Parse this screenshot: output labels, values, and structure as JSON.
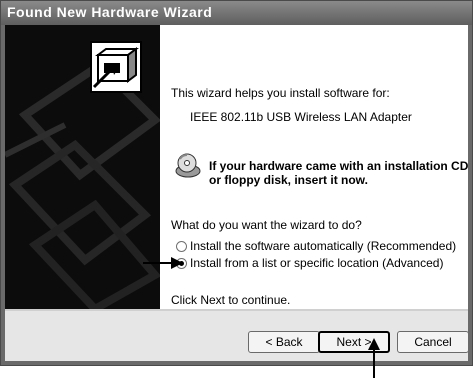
{
  "window": {
    "title": "Found New Hardware Wizard"
  },
  "content": {
    "intro": "This wizard helps you install software for:",
    "device": "IEEE 802.11b USB Wireless LAN Adapter",
    "cd_line1": "If your hardware came with an installation CD",
    "cd_line2": "or floppy disk, insert it now.",
    "question": "What do you want the wizard to do?",
    "option_auto": "Install the software automatically (Recommended)",
    "option_list": "Install from a list or specific location (Advanced)",
    "continue": "Click Next to continue."
  },
  "buttons": {
    "back": "< Back",
    "next": "Next >",
    "cancel": "Cancel"
  },
  "icons": {
    "wizard": "hardware-icon",
    "cd": "cd-icon"
  }
}
